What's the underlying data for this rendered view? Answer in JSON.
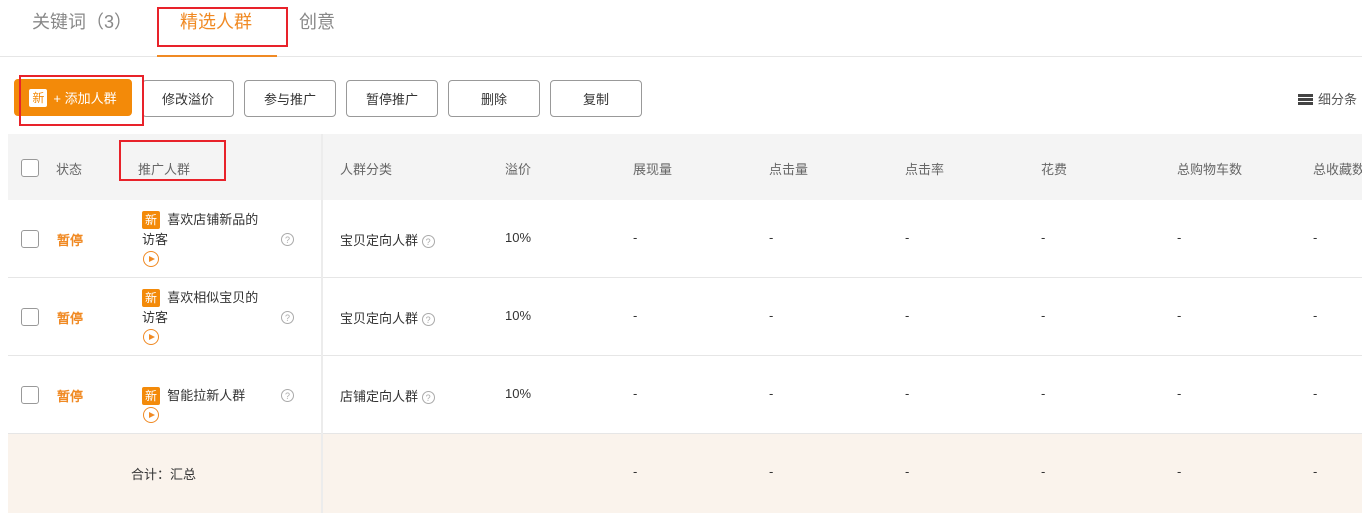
{
  "tabs": [
    {
      "label": "关键词（3）"
    },
    {
      "label": "精选人群"
    },
    {
      "label": "创意"
    }
  ],
  "toolbar": {
    "new_badge": "新",
    "add": "+ 添加人群",
    "edit_premium": "修改溢价",
    "join": "参与推广",
    "pause": "暂停推广",
    "delete": "删除",
    "copy": "复制",
    "segment": "细分条"
  },
  "columns": [
    "状态",
    "推广人群",
    "人群分类",
    "溢价",
    "展现量",
    "点击量",
    "点击率",
    "花费",
    "总购物车数",
    "总收藏数"
  ],
  "rows": [
    {
      "status": "暂停",
      "badge": "新",
      "name": "喜欢店铺新品的",
      "name2": "访客",
      "category": "宝贝定向人群",
      "premium": "10%",
      "impressions": "-",
      "clicks": "-",
      "ctr": "-",
      "cost": "-",
      "cart": "-",
      "fav": "-"
    },
    {
      "status": "暂停",
      "badge": "新",
      "name": "喜欢相似宝贝的",
      "name2": "访客",
      "category": "宝贝定向人群",
      "premium": "10%",
      "impressions": "-",
      "clicks": "-",
      "ctr": "-",
      "cost": "-",
      "cart": "-",
      "fav": "-"
    },
    {
      "status": "暂停",
      "badge": "新",
      "name": "智能拉新人群",
      "name2": "",
      "category": "店铺定向人群",
      "premium": "10%",
      "impressions": "-",
      "clicks": "-",
      "ctr": "-",
      "cost": "-",
      "cart": "-",
      "fav": "-"
    }
  ],
  "summary": {
    "label": "合计：汇总",
    "impressions": "-",
    "clicks": "-",
    "ctr": "-",
    "cost": "-",
    "cart": "-",
    "fav": "-"
  },
  "colors": {
    "accent": "#f08a24",
    "annotation": "#e8222a"
  }
}
